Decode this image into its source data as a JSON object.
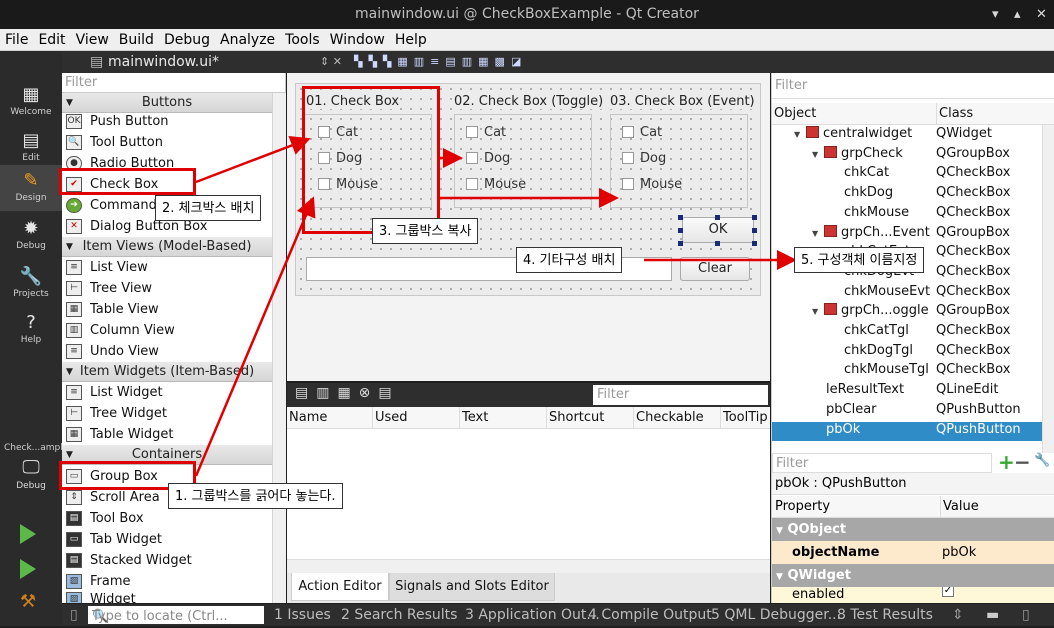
{
  "window": {
    "title": "mainwindow.ui @ CheckBoxExample - Qt Creator"
  },
  "menu": [
    "File",
    "Edit",
    "View",
    "Build",
    "Debug",
    "Analyze",
    "Tools",
    "Window",
    "Help"
  ],
  "modes": [
    {
      "label": "Welcome",
      "icon": "▦"
    },
    {
      "label": "Edit",
      "icon": "▤"
    },
    {
      "label": "Design",
      "icon": "✎"
    },
    {
      "label": "Debug",
      "icon": "✹"
    },
    {
      "label": "Projects",
      "icon": "🔧"
    },
    {
      "label": "Help",
      "icon": "?"
    }
  ],
  "kit": {
    "project": "Check...ample",
    "config": "Debug"
  },
  "document": {
    "filename": "mainwindow.ui*"
  },
  "widgetbox": {
    "filter": "Filter",
    "categories": [
      "Buttons",
      "Item Views (Model-Based)",
      "Item Widgets (Item-Based)",
      "Containers"
    ],
    "buttons": [
      "Push Button",
      "Tool Button",
      "Radio Button",
      "Check Box",
      "Command Link Button",
      "Dialog Button Box"
    ],
    "itemviews": [
      "List View",
      "Tree View",
      "Table View",
      "Column View",
      "Undo View"
    ],
    "itemwidgets": [
      "List Widget",
      "Tree Widget",
      "Table Widget"
    ],
    "containers": [
      "Group Box",
      "Scroll Area",
      "Tool Box",
      "Tab Widget",
      "Stacked Widget",
      "Frame",
      "Widget"
    ]
  },
  "form": {
    "groups": [
      {
        "title": "01. Check Box",
        "items": [
          "Cat",
          "Dog",
          "Mouse"
        ]
      },
      {
        "title": "02. Check Box (Toggle)",
        "items": [
          "Cat",
          "Dog",
          "Mouse"
        ]
      },
      {
        "title": "03. Check Box (Event)",
        "items": [
          "Cat",
          "Dog",
          "Mouse"
        ]
      }
    ],
    "ok": "OK",
    "clear": "Clear"
  },
  "action_editor": {
    "filter": "Filter",
    "columns": [
      "Name",
      "Used",
      "Text",
      "Shortcut",
      "Checkable",
      "ToolTip"
    ],
    "tabs": [
      "Action Editor",
      "Signals and Slots Editor"
    ]
  },
  "object_inspector": {
    "filter": "Filter",
    "columns": [
      "Object",
      "Class"
    ],
    "rows": [
      {
        "name": "centralwidget",
        "class": "QWidget",
        "level": 1,
        "expand": true,
        "icon": true
      },
      {
        "name": "grpCheck",
        "class": "QGroupBox",
        "level": 2,
        "expand": true,
        "icon": true
      },
      {
        "name": "chkCat",
        "class": "QCheckBox",
        "level": 3
      },
      {
        "name": "chkDog",
        "class": "QCheckBox",
        "level": 3
      },
      {
        "name": "chkMouse",
        "class": "QCheckBox",
        "level": 3
      },
      {
        "name": "grpCh...Event",
        "class": "QGroupBox",
        "level": 2,
        "expand": true,
        "icon": true
      },
      {
        "name": "chkCatEvt",
        "class": "QCheckBox",
        "level": 3
      },
      {
        "name": "chkDogEvt",
        "class": "QCheckBox",
        "level": 3
      },
      {
        "name": "chkMouseEvt",
        "class": "QCheckBox",
        "level": 3
      },
      {
        "name": "grpCh...oggle",
        "class": "QGroupBox",
        "level": 2,
        "expand": true,
        "icon": true
      },
      {
        "name": "chkCatTgl",
        "class": "QCheckBox",
        "level": 3
      },
      {
        "name": "chkDogTgl",
        "class": "QCheckBox",
        "level": 3
      },
      {
        "name": "chkMouseTgl",
        "class": "QCheckBox",
        "level": 3
      },
      {
        "name": "leResultText",
        "class": "QLineEdit",
        "level": 2
      },
      {
        "name": "pbClear",
        "class": "QPushButton",
        "level": 2
      },
      {
        "name": "pbOk",
        "class": "QPushButton",
        "level": 2,
        "selected": true
      }
    ]
  },
  "property_editor": {
    "filter": "Filter",
    "object": "pbOk : QPushButton",
    "columns": [
      "Property",
      "Value"
    ],
    "sections": [
      "QObject",
      "QWidget"
    ],
    "object_name_label": "objectName",
    "object_name_value": "pbOk",
    "enabled_label": "enabled",
    "enabled_value": "✓"
  },
  "statusbar": {
    "locate": "Type to locate (Ctrl...",
    "items": [
      "1 Issues",
      "2 Search Results",
      "3 Application Out...",
      "4 Compile Output",
      "5 QML Debugger...",
      "8 Test Results"
    ]
  },
  "annotations": [
    "1. 그룹박스를 긁어다 놓는다.",
    "2. 체크박스 배치",
    "3. 그룹박스 복사",
    "4. 기타구성 배치",
    "5. 구성객체 이름지정"
  ],
  "colors": {
    "annotation": "#e00000",
    "selection": "#308cc6",
    "dark": "#2e2e2e"
  }
}
